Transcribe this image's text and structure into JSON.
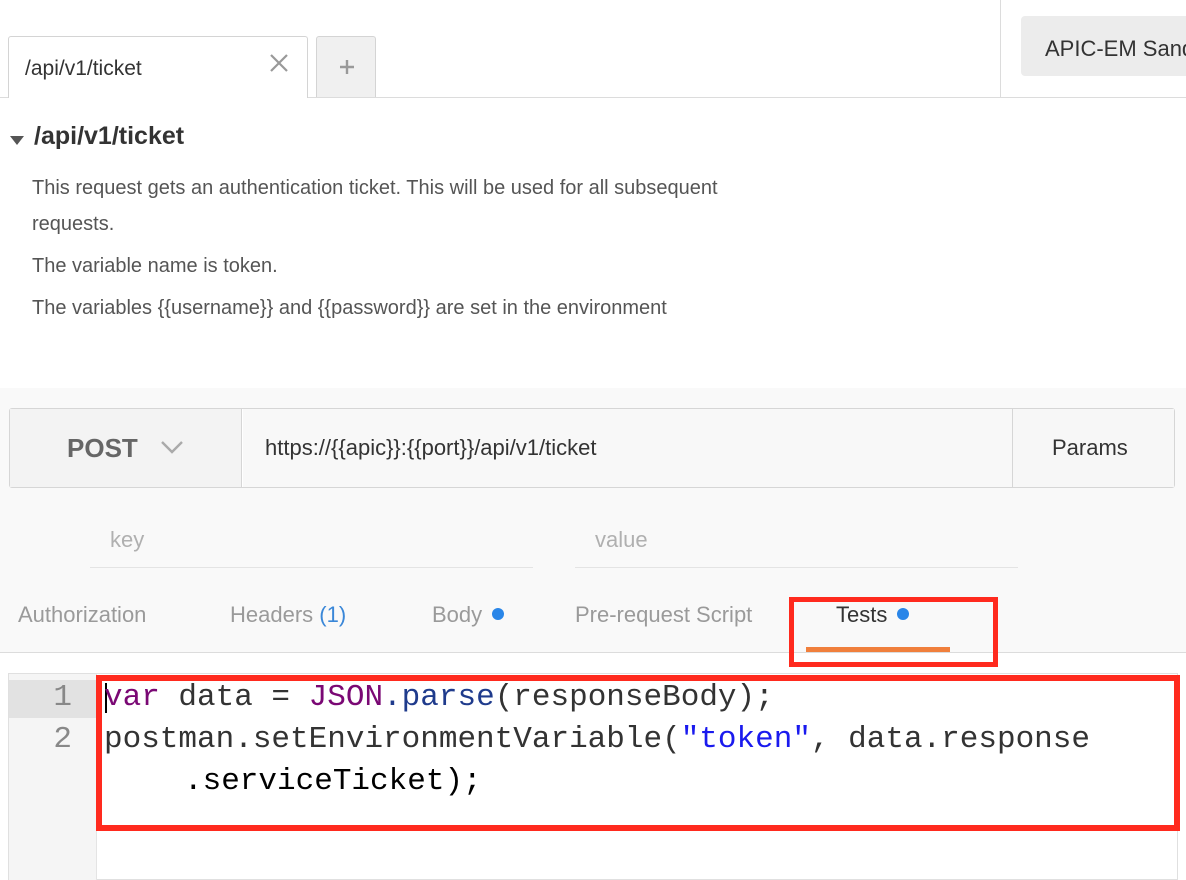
{
  "tabs": {
    "active_label": "/api/v1/ticket",
    "add_label": "+"
  },
  "environment": {
    "selected": "APIC-EM Sandbox"
  },
  "request": {
    "title": "/api/v1/ticket",
    "description": [
      "This request gets an authentication ticket. This will be used for all subsequent requests.",
      "The variable name is token.",
      "The variables {{username}} and {{password}} are set in the environment"
    ],
    "method": "POST",
    "url": "https://{{apic}}:{{port}}/api/v1/ticket",
    "params_label": "Params",
    "key_placeholder": "key",
    "value_placeholder": "value"
  },
  "subtabs": {
    "authorization": "Authorization",
    "headers": "Headers",
    "headers_count": "(1)",
    "body": "Body",
    "prerequest": "Pre-request Script",
    "tests": "Tests"
  },
  "editor": {
    "line_numbers": [
      "1",
      "2"
    ],
    "line1": {
      "kw": "var",
      "ident": " data = ",
      "obj": "JSON",
      "method": ".parse",
      "rest": "(responseBody);"
    },
    "line2": {
      "prefix": "postman.setEnvironmentVariable(",
      "string": "\"token\"",
      "suffix": ", data.response"
    },
    "line2_wrap": ".serviceTicket);"
  },
  "colors": {
    "highlight_red": "#ff2a1e",
    "active_tab_orange": "#f07f3c",
    "dot_blue": "#2a86e8",
    "keyword_purple": "#7a0874",
    "string_blue": "#1a1aee"
  },
  "icons": {
    "tab_close": "close-icon",
    "method_dropdown": "chevron-down-icon",
    "collapse": "caret-down-icon"
  }
}
